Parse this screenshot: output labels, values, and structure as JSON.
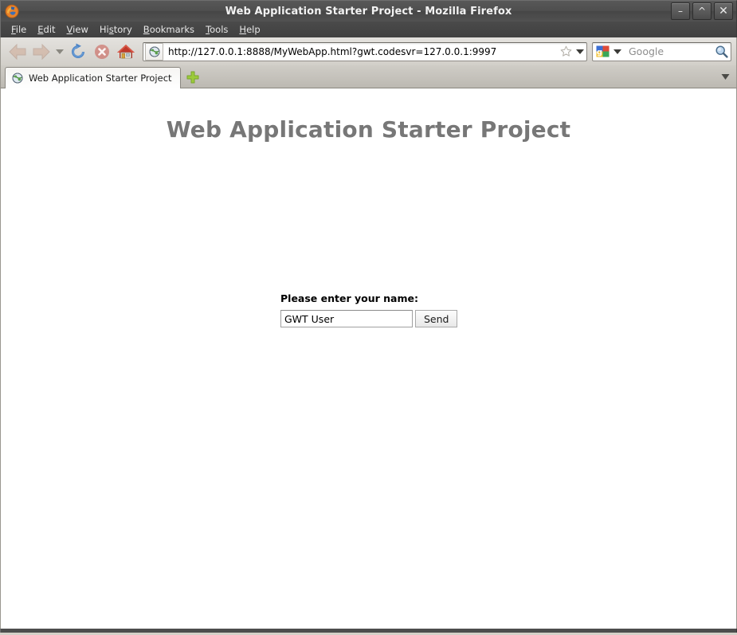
{
  "window": {
    "title": "Web Application Starter Project - Mozilla Firefox",
    "app_icon": "firefox-logo-icon",
    "controls": {
      "minimize": "–",
      "maximize": "^",
      "close": "✕"
    }
  },
  "menubar": {
    "items": [
      {
        "label": "File",
        "accel": "F",
        "pre": "",
        "post": "ile"
      },
      {
        "label": "Edit",
        "accel": "E",
        "pre": "",
        "post": "dit"
      },
      {
        "label": "View",
        "accel": "V",
        "pre": "",
        "post": "iew"
      },
      {
        "label": "History",
        "accel": "s",
        "pre": "Hi",
        "post": "tory"
      },
      {
        "label": "Bookmarks",
        "accel": "B",
        "pre": "",
        "post": "ookmarks"
      },
      {
        "label": "Tools",
        "accel": "T",
        "pre": "",
        "post": "ools"
      },
      {
        "label": "Help",
        "accel": "H",
        "pre": "",
        "post": "elp"
      }
    ]
  },
  "toolbar": {
    "back_icon": "back-arrow-icon",
    "forward_icon": "forward-arrow-icon",
    "history_dropdown_icon": "chevron-down-icon",
    "reload_icon": "reload-icon",
    "stop_icon": "stop-icon",
    "home_icon": "home-icon",
    "url": "http://127.0.0.1:8888/MyWebApp.html?gwt.codesvr=127.0.0.1:9997",
    "identity_icon": "site-identity-globe-icon",
    "bookmark_star_icon": "star-icon",
    "url_dropdown_icon": "chevron-down-icon",
    "search_engine": "google-logo-icon",
    "search_placeholder": "Google",
    "search_value": "",
    "search_dropdown_icon": "chevron-down-icon",
    "search_go_icon": "magnifier-icon"
  },
  "tabs": {
    "items": [
      {
        "label": "Web Application Starter Project",
        "favicon": "globe-favicon-icon",
        "active": true
      }
    ],
    "new_tab_icon": "plus-icon",
    "list_all_tabs_icon": "chevron-down-icon"
  },
  "page": {
    "heading": "Web Application Starter Project",
    "form": {
      "label": "Please enter your name:",
      "name_value": "GWT User",
      "name_placeholder": "",
      "send_label": "Send"
    }
  },
  "colors": {
    "titlebar": "#4e4e4e",
    "toolbar": "#dbd8d3",
    "heading": "#777777",
    "page_bg": "#ffffff",
    "accent_green": "#8cc63f",
    "home_red": "#c0392b"
  }
}
